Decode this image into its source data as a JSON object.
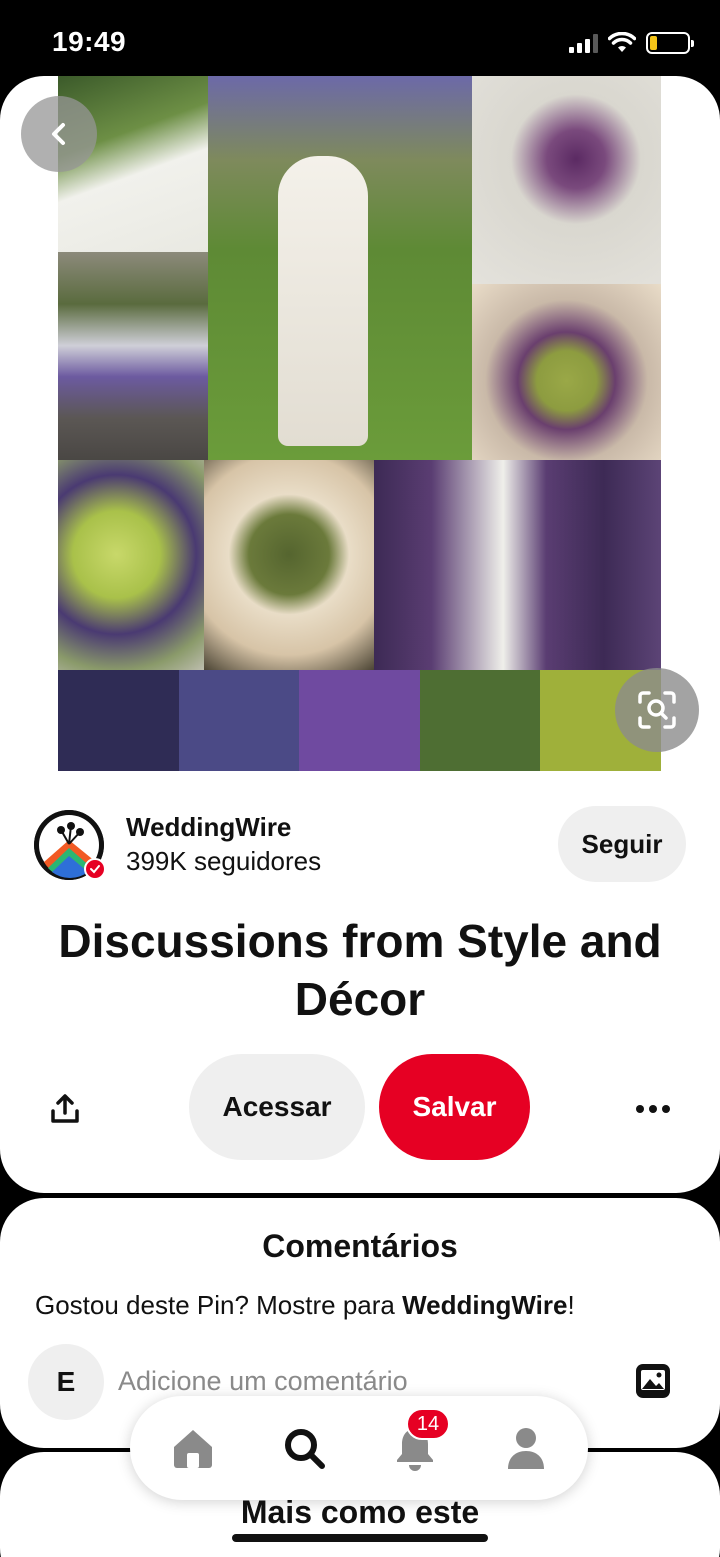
{
  "status_bar": {
    "time": "19:49",
    "battery_level": 0.2,
    "battery_color": "#f5c518"
  },
  "pin": {
    "image_icons": {
      "back": "chevron-left-icon",
      "visual_search": "visual-search-icon"
    },
    "palette_colors": [
      "#2f2c55",
      "#4b4a86",
      "#6f4aa0",
      "#4e6e33",
      "#9fb03a"
    ],
    "creator": {
      "name": "WeddingWire",
      "followers": "399K seguidores",
      "follow_label": "Seguir"
    },
    "title": "Discussions from Style and Décor",
    "actions": {
      "share_icon": "share-icon",
      "access_label": "Acessar",
      "save_label": "Salvar",
      "more_icon": "ellipsis-icon"
    }
  },
  "comments": {
    "title": "Comentários",
    "prompt_text": "Gostou deste Pin? Mostre para ",
    "prompt_creator": "WeddingWire",
    "prompt_end": "!",
    "user_initial": "E",
    "input_placeholder": "Adicione um comentário",
    "photo_icon": "photo-icon"
  },
  "more_like_this": {
    "title": "Mais como este"
  },
  "bottom_nav": {
    "items": [
      "home-icon",
      "search-icon",
      "notifications-icon",
      "profile-icon"
    ],
    "notifications_badge": "14"
  },
  "colors": {
    "brand_red": "#e60023",
    "button_gray": "#efefef"
  }
}
